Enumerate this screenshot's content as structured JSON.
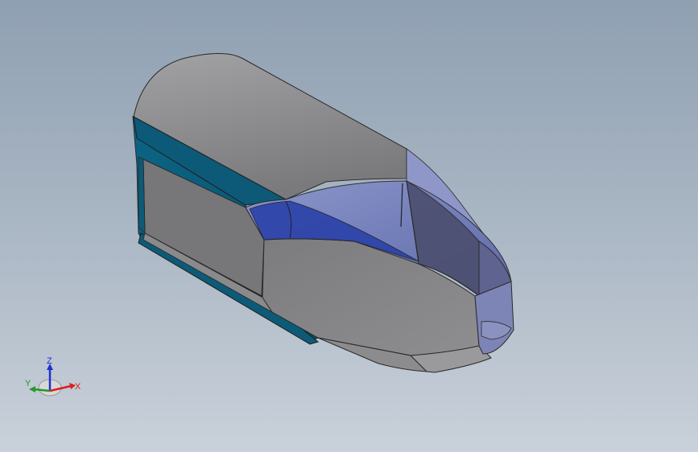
{
  "viewport": {
    "background_top": "#8fa0b2",
    "background_bottom": "#c9d1da"
  },
  "model": {
    "body_color": "#7f7f80",
    "trim_color": "#0d5a78",
    "glass_color": "#6f7fc0"
  },
  "triad": {
    "x_label": "X",
    "y_label": "Y",
    "z_label": "Z",
    "x_color": "#d81f1f",
    "y_color": "#1f9a2a",
    "z_color": "#1f2fcf"
  }
}
